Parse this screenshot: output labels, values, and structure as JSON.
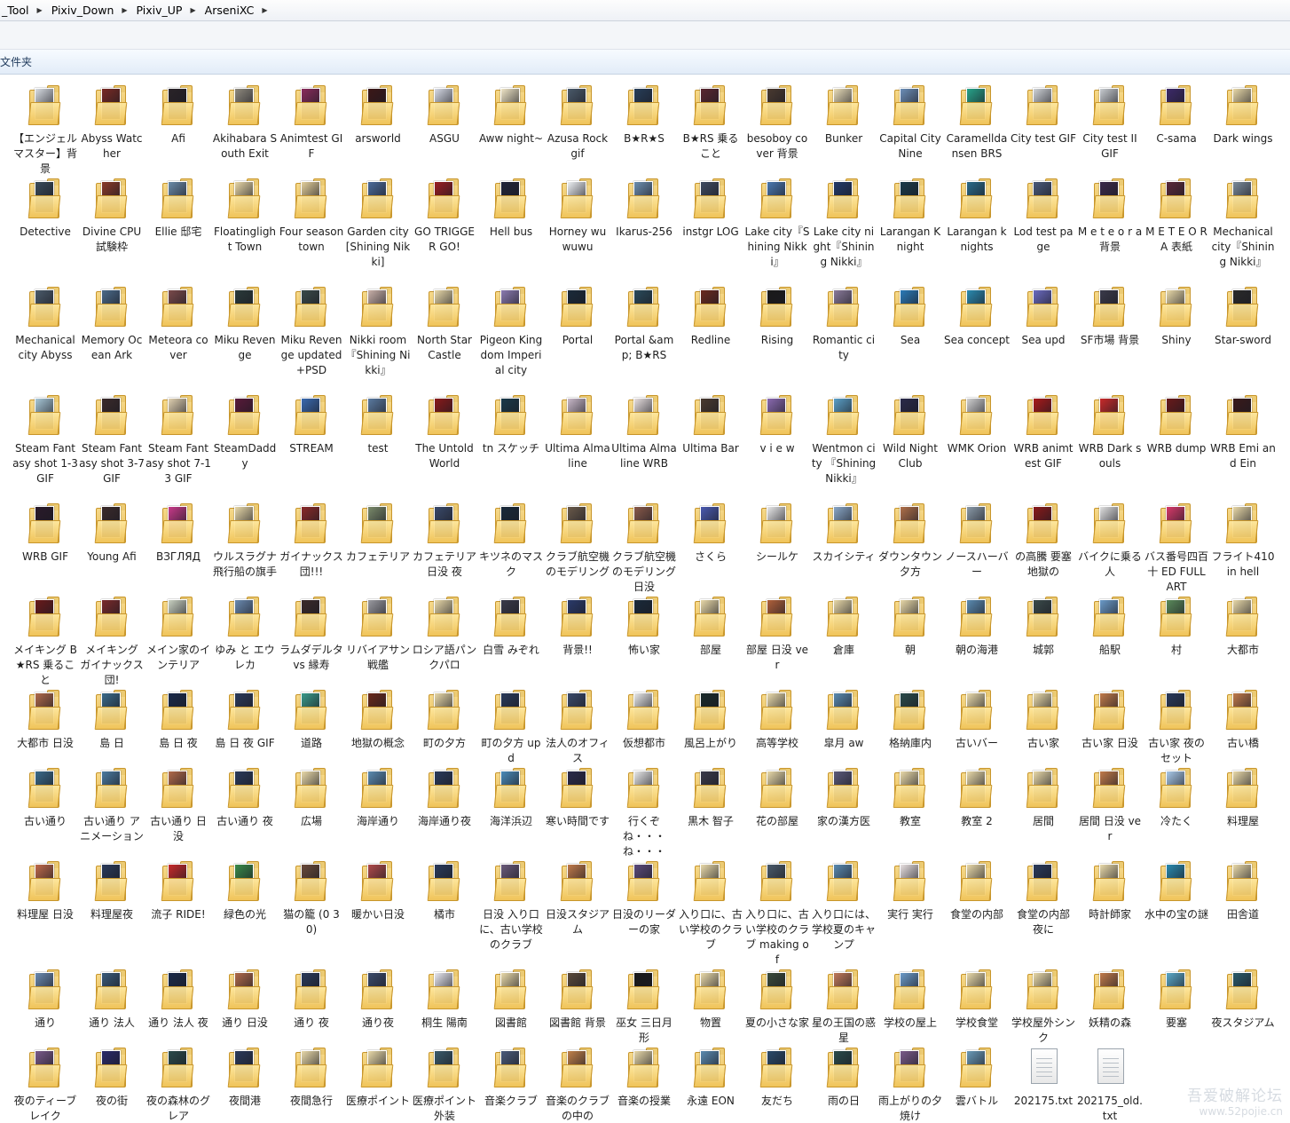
{
  "breadcrumb": [
    "_Tool",
    "Pixiv_Down",
    "Pixiv_UP",
    "ArseniXC"
  ],
  "toolbar": {
    "new_folder_label": "文件夹"
  },
  "watermark": {
    "line1": "吾爱破解论坛",
    "line2": "www.52pojie.cn"
  },
  "items": [
    {
      "label": "【エンジェルマスター】背景",
      "type": "folder",
      "color": "#d8dde3"
    },
    {
      "label": "Abyss Watcher",
      "type": "folder",
      "color": "#7a2a24"
    },
    {
      "label": "Afi",
      "type": "folder",
      "color": "#2a2328"
    },
    {
      "label": "Akihabara South Exit",
      "type": "folder",
      "color": "#8f8a7e"
    },
    {
      "label": "Animtest GIF",
      "type": "folder",
      "color": "#8a2b5c"
    },
    {
      "label": "arsworld",
      "type": "folder",
      "color": "#3c1717"
    },
    {
      "label": "ASGU",
      "type": "folder",
      "color": "#d7dbe6"
    },
    {
      "label": "Aww night~",
      "type": "folder",
      "color": "#efe5c6"
    },
    {
      "label": "Azusa Rock gif",
      "type": "folder",
      "color": "#4a5a6a"
    },
    {
      "label": "B★R★S",
      "type": "folder",
      "color": "#273e59"
    },
    {
      "label": "B★RS 乗ること",
      "type": "folder",
      "color": "#5a2730"
    },
    {
      "label": "besoboy cover 背景",
      "type": "folder",
      "color": "#4a3a30"
    },
    {
      "label": "Bunker",
      "type": "folder",
      "color": "#e8dcb8"
    },
    {
      "label": "Capital City Nine",
      "type": "folder",
      "color": "#6c8fb8"
    },
    {
      "label": "Caramelldansen BRS",
      "type": "folder",
      "color": "#27a38a"
    },
    {
      "label": "City test GIF",
      "type": "folder",
      "color": "#cfd3d7"
    },
    {
      "label": "City test II GIF",
      "type": "folder",
      "color": "#c8ccd0"
    },
    {
      "label": "C-sama",
      "type": "folder",
      "color": "#3d2a6a"
    },
    {
      "label": "Dark wings",
      "type": "folder",
      "color": "#e8d8a8"
    },
    {
      "label": "Detective",
      "type": "folder",
      "color": "#3a4b5a"
    },
    {
      "label": "Divine CPU 試験枠",
      "type": "folder",
      "color": "#8a3a2a"
    },
    {
      "label": "Ellie 邸宅",
      "type": "folder",
      "color": "#6a8aa8"
    },
    {
      "label": "Floatinglight Town",
      "type": "folder",
      "color": "#e7d6a6"
    },
    {
      "label": "Four season town",
      "type": "folder",
      "color": "#e3cf9a"
    },
    {
      "label": "Garden city [Shining Nikki]",
      "type": "folder",
      "color": "#4a6a9a"
    },
    {
      "label": "GO TRIGGER GO!",
      "type": "folder",
      "color": "#9a1e22"
    },
    {
      "label": "Hell bus",
      "type": "folder",
      "color": "#22263a"
    },
    {
      "label": "Horney wuwuwu",
      "type": "folder",
      "color": "#eceff2"
    },
    {
      "label": "Ikarus-256",
      "type": "folder",
      "color": "#6d8fb0"
    },
    {
      "label": "instgr LOG",
      "type": "folder",
      "color": "#3e4a60"
    },
    {
      "label": "Lake city『Shining Nikki』",
      "type": "folder",
      "color": "#4a78b0"
    },
    {
      "label": "Lake city night『Shining Nikki』",
      "type": "folder",
      "color": "#223a6a"
    },
    {
      "label": "Larangan Knight",
      "type": "folder",
      "color": "#1a3a4a"
    },
    {
      "label": "Larangan knights",
      "type": "folder",
      "color": "#2a6a8a"
    },
    {
      "label": "Lod test page",
      "type": "folder",
      "color": "#4a5a7a"
    },
    {
      "label": "M e t e o r a 背景",
      "type": "folder",
      "color": "#3a2a4a"
    },
    {
      "label": "M E T E O R A 表紙",
      "type": "folder",
      "color": "#5a2a3a"
    },
    {
      "label": "Mechanical city『Shining Nikki』",
      "type": "folder",
      "color": "#7a8a9a"
    },
    {
      "label": "Mechanical city Abyss",
      "type": "folder",
      "color": "#4a5a6a"
    },
    {
      "label": "Memory Ocean Ark",
      "type": "folder",
      "color": "#4a6a8a"
    },
    {
      "label": "Meteora cover",
      "type": "folder",
      "color": "#7a4a4a"
    },
    {
      "label": "Miku Revenge",
      "type": "folder",
      "color": "#2a3a3a"
    },
    {
      "label": "Miku Revenge updated +PSD",
      "type": "folder",
      "color": "#3a4a4a"
    },
    {
      "label": "Nikki room『Shining Nikki』",
      "type": "folder",
      "color": "#c8b0a8"
    },
    {
      "label": "North Star Castle",
      "type": "folder",
      "color": "#e8d8a8"
    },
    {
      "label": "Pigeon Kingdom Imperial city",
      "type": "folder",
      "color": "#8a7ab0"
    },
    {
      "label": "Portal",
      "type": "folder",
      "color": "#1a2a3a"
    },
    {
      "label": "Portal &amp; B★RS",
      "type": "folder",
      "color": "#2a4a5a"
    },
    {
      "label": "Redline",
      "type": "folder",
      "color": "#6a2a20"
    },
    {
      "label": "Rising",
      "type": "folder",
      "color": "#1a1a1a"
    },
    {
      "label": "Romantic city",
      "type": "folder",
      "color": "#8a7a9a"
    },
    {
      "label": "Sea",
      "type": "folder",
      "color": "#2a7ab8"
    },
    {
      "label": "Sea concept",
      "type": "folder",
      "color": "#2a8ab0"
    },
    {
      "label": "Sea upd",
      "type": "folder",
      "color": "#6a6ac0"
    },
    {
      "label": "SF市場 背景",
      "type": "folder",
      "color": "#3a3a4a"
    },
    {
      "label": "Shiny",
      "type": "folder",
      "color": "#e8d8a8"
    },
    {
      "label": "Star-sword",
      "type": "folder",
      "color": "#2a2a2a"
    },
    {
      "label": "Steam Fantasy shot 1-3 GIF",
      "type": "folder",
      "color": "#a8c8d8"
    },
    {
      "label": "Steam Fantasy shot 3-7 GIF",
      "type": "folder",
      "color": "#3a2a2a"
    },
    {
      "label": "Steam Fantasy shot 7-13 GIF",
      "type": "folder",
      "color": "#e0d0b0"
    },
    {
      "label": "SteamDaddy",
      "type": "folder",
      "color": "#5a1a3a"
    },
    {
      "label": "STREAM",
      "type": "folder",
      "color": "#3a6ab0"
    },
    {
      "label": "test",
      "type": "folder",
      "color": "#5a7aa0"
    },
    {
      "label": "The Untold World",
      "type": "folder",
      "color": "#8a1a1a"
    },
    {
      "label": "tn スケッチ",
      "type": "folder",
      "color": "#1a3a4a"
    },
    {
      "label": "Ultima Almaline",
      "type": "folder",
      "color": "#c8b8c8"
    },
    {
      "label": "Ultima Almaline WRB",
      "type": "folder",
      "color": "#e8e0e0"
    },
    {
      "label": "Ultima Bar",
      "type": "folder",
      "color": "#4a3a30"
    },
    {
      "label": "v i e w",
      "type": "folder",
      "color": "#8a6ab0"
    },
    {
      "label": "Wentmon city 『Shining Nikki』",
      "type": "folder",
      "color": "#5aa0c8"
    },
    {
      "label": "Wild Night Club",
      "type": "folder",
      "color": "#2a2a4a"
    },
    {
      "label": "WMK Orion",
      "type": "folder",
      "color": "#d0d0d0"
    },
    {
      "label": "WRB animtest GIF",
      "type": "folder",
      "color": "#aa1a1a"
    },
    {
      "label": "WRB Dark souls",
      "type": "folder",
      "color": "#c82a2a"
    },
    {
      "label": "WRB dump",
      "type": "folder",
      "color": "#6a1a1a"
    },
    {
      "label": "WRB Emi and Ein",
      "type": "folder",
      "color": "#3a1a1a"
    },
    {
      "label": "WRB GIF",
      "type": "folder",
      "color": "#2a1a2a"
    },
    {
      "label": "Young Afi",
      "type": "folder",
      "color": "#3a2a2a"
    },
    {
      "label": "ВЗГЛЯД",
      "type": "folder",
      "color": "#c83a8a"
    },
    {
      "label": "ウルスラグナ飛行船の旗手",
      "type": "folder",
      "color": "#e8d8a8"
    },
    {
      "label": "ガイナックス団!!!",
      "type": "folder",
      "color": "#8a2a2a"
    },
    {
      "label": "カフェテリア",
      "type": "folder",
      "color": "#7a8a6a"
    },
    {
      "label": "カフェテリア 日没 夜",
      "type": "folder",
      "color": "#3a4a6a"
    },
    {
      "label": "キツネのマスク",
      "type": "folder",
      "color": "#1a2a3a"
    },
    {
      "label": "クラブ航空機のモデリング",
      "type": "folder",
      "color": "#6a5a4a"
    },
    {
      "label": "クラブ航空機のモデリング 日没",
      "type": "folder",
      "color": "#8a5a4a"
    },
    {
      "label": "さくら",
      "type": "folder",
      "color": "#4a5ab0"
    },
    {
      "label": "シールケ",
      "type": "folder",
      "color": "#e8e8e8"
    },
    {
      "label": "スカイシティ",
      "type": "folder",
      "color": "#8aa8c8"
    },
    {
      "label": "ダウンタウン夕方",
      "type": "folder",
      "color": "#b0704a"
    },
    {
      "label": "ノースハーバー",
      "type": "folder",
      "color": "#8a9aa8"
    },
    {
      "label": "の高騰 要塞 地獄の",
      "type": "folder",
      "color": "#8a1a1a"
    },
    {
      "label": "バイクに乗る人",
      "type": "folder",
      "color": "#e0e0e0"
    },
    {
      "label": "バス番号四百十 ED FULL ART",
      "type": "folder",
      "color": "#d83a6a"
    },
    {
      "label": "フライト410 in hell",
      "type": "folder",
      "color": "#e8d8a8"
    },
    {
      "label": "メイキング B★RS 乗ること",
      "type": "folder",
      "color": "#6a1a1a"
    },
    {
      "label": "メイキング ガイナックス団!",
      "type": "folder",
      "color": "#7a2a2a"
    },
    {
      "label": "メイン家のインテリア",
      "type": "folder",
      "color": "#c8d0c0"
    },
    {
      "label": "ゆみ と エウレカ",
      "type": "folder",
      "color": "#6a8ab0"
    },
    {
      "label": "ラムダデルタ vs 縁寿",
      "type": "folder",
      "color": "#3a2a2a"
    },
    {
      "label": "リバイアサン戦艦",
      "type": "folder",
      "color": "#9a9aa0"
    },
    {
      "label": "ロシア語パンクパロ",
      "type": "folder",
      "color": "#e8d8a8"
    },
    {
      "label": "白雪 みぞれ",
      "type": "folder",
      "color": "#3a3a4a"
    },
    {
      "label": "背景!!",
      "type": "folder",
      "color": "#2a3a6a"
    },
    {
      "label": "怖い家",
      "type": "folder",
      "color": "#1a2a3a"
    },
    {
      "label": "部屋",
      "type": "folder",
      "color": "#e8d8a8"
    },
    {
      "label": "部屋 日没 ver",
      "type": "folder",
      "color": "#b0603a"
    },
    {
      "label": "倉庫",
      "type": "folder",
      "color": "#e8d8a8"
    },
    {
      "label": "朝",
      "type": "folder",
      "color": "#e8d8a8"
    },
    {
      "label": "朝の海港",
      "type": "folder",
      "color": "#5a8ab0"
    },
    {
      "label": "城郭",
      "type": "folder",
      "color": "#3a4a4a"
    },
    {
      "label": "船駅",
      "type": "folder",
      "color": "#6a9ac8"
    },
    {
      "label": "村",
      "type": "folder",
      "color": "#5a8a5a"
    },
    {
      "label": "大都市",
      "type": "folder",
      "color": "#e8d8a8"
    },
    {
      "label": "大都市 日没",
      "type": "folder",
      "color": "#b06a4a"
    },
    {
      "label": "島 日",
      "type": "folder",
      "color": "#3a6a8a"
    },
    {
      "label": "島 日 夜",
      "type": "folder",
      "color": "#1a2a4a"
    },
    {
      "label": "島 日 夜 GIF",
      "type": "folder",
      "color": "#2a3a5a"
    },
    {
      "label": "道路",
      "type": "folder",
      "color": "#3a9a8a"
    },
    {
      "label": "地獄の概念",
      "type": "folder",
      "color": "#6a2a1a"
    },
    {
      "label": "町の夕方",
      "type": "folder",
      "color": "#e8d8a8"
    },
    {
      "label": "町の夕方 upd",
      "type": "folder",
      "color": "#2a3a5a"
    },
    {
      "label": "法人のオフィス",
      "type": "folder",
      "color": "#3a4a6a"
    },
    {
      "label": "仮想都市",
      "type": "folder",
      "color": "#e8e8e8"
    },
    {
      "label": "風呂上がり",
      "type": "folder",
      "color": "#1a2a2a"
    },
    {
      "label": "高等学校",
      "type": "folder",
      "color": "#e8d8a8"
    },
    {
      "label": "皐月 aw",
      "type": "folder",
      "color": "#5a8ab0"
    },
    {
      "label": "格納庫内",
      "type": "folder",
      "color": "#2a4a4a"
    },
    {
      "label": "古いバー",
      "type": "folder",
      "color": "#e8d8a8"
    },
    {
      "label": "古い家",
      "type": "folder",
      "color": "#e8d8a8"
    },
    {
      "label": "古い家 日没",
      "type": "folder",
      "color": "#c07a4a"
    },
    {
      "label": "古い家 夜のセット",
      "type": "folder",
      "color": "#2a3a5a"
    },
    {
      "label": "古い橋",
      "type": "folder",
      "color": "#c07a4a"
    },
    {
      "label": "古い通り",
      "type": "folder",
      "color": "#3a6a8a"
    },
    {
      "label": "古い通り アニメーション",
      "type": "folder",
      "color": "#4a7aa0"
    },
    {
      "label": "古い通り 日没",
      "type": "folder",
      "color": "#b06a4a"
    },
    {
      "label": "古い通り 夜",
      "type": "folder",
      "color": "#2a3a5a"
    },
    {
      "label": "広場",
      "type": "folder",
      "color": "#e8d8a8"
    },
    {
      "label": "海岸通り",
      "type": "folder",
      "color": "#5a8ab0"
    },
    {
      "label": "海岸通り夜",
      "type": "folder",
      "color": "#2a3a5a"
    },
    {
      "label": "海洋浜辺",
      "type": "folder",
      "color": "#4a8ab8"
    },
    {
      "label": "寒い時間です",
      "type": "folder",
      "color": "#2a2a4a"
    },
    {
      "label": "行くぞ ね・・・ね・・・",
      "type": "folder",
      "color": "#e8e8e8"
    },
    {
      "label": "黒木 智子",
      "type": "folder",
      "color": "#3a3a4a"
    },
    {
      "label": "花の部屋",
      "type": "folder",
      "color": "#e8d8a8"
    },
    {
      "label": "家の漢方医",
      "type": "folder",
      "color": "#5a5a7a"
    },
    {
      "label": "教室",
      "type": "folder",
      "color": "#e8d8a8"
    },
    {
      "label": "教室 2",
      "type": "folder",
      "color": "#e8d8a8"
    },
    {
      "label": "居間",
      "type": "folder",
      "color": "#e8d8a8"
    },
    {
      "label": "居間 日没 ver",
      "type": "folder",
      "color": "#c07a4a"
    },
    {
      "label": "冷たく",
      "type": "folder",
      "color": "#a8c8e8"
    },
    {
      "label": "料理屋",
      "type": "folder",
      "color": "#e8d8a8"
    },
    {
      "label": "料理屋 日没",
      "type": "folder",
      "color": "#c06a4a"
    },
    {
      "label": "料理屋夜",
      "type": "folder",
      "color": "#2a3a5a"
    },
    {
      "label": "流子 RIDE!",
      "type": "folder",
      "color": "#c82a2a"
    },
    {
      "label": "緑色の光",
      "type": "folder",
      "color": "#3a8a4a"
    },
    {
      "label": "猫の籠 (0 30)",
      "type": "folder",
      "color": "#6a4a3a"
    },
    {
      "label": "暖かい日没",
      "type": "folder",
      "color": "#b04a4a"
    },
    {
      "label": "橘市",
      "type": "folder",
      "color": "#2a3a5a"
    },
    {
      "label": "日没 入り口に、古い学校のクラブ",
      "type": "folder",
      "color": "#6a5a7a"
    },
    {
      "label": "日没スタジアム",
      "type": "folder",
      "color": "#c07a4a"
    },
    {
      "label": "日没のリーダーの家",
      "type": "folder",
      "color": "#5a4a7a"
    },
    {
      "label": "入り口に、古い学校のクラブ",
      "type": "folder",
      "color": "#e8d8a8"
    },
    {
      "label": "入り口に、古い学校のクラブ making of",
      "type": "folder",
      "color": "#4a5a6a"
    },
    {
      "label": "入り口には、学校夏のキャンプ",
      "type": "folder",
      "color": "#5a8ab0"
    },
    {
      "label": "実行 実行",
      "type": "folder",
      "color": "#e8e0e0"
    },
    {
      "label": "食堂の内部",
      "type": "folder",
      "color": "#e8d8a8"
    },
    {
      "label": "食堂の内部 夜に",
      "type": "folder",
      "color": "#2a3a5a"
    },
    {
      "label": "時計師家",
      "type": "folder",
      "color": "#e8d8a8"
    },
    {
      "label": "水中の宝の謎",
      "type": "folder",
      "color": "#2a8ab0"
    },
    {
      "label": "田舎道",
      "type": "folder",
      "color": "#e8d8a8"
    },
    {
      "label": "通り",
      "type": "folder",
      "color": "#6a8ab0"
    },
    {
      "label": "通り 法人",
      "type": "folder",
      "color": "#3a5a7a"
    },
    {
      "label": "通り 法人 夜",
      "type": "folder",
      "color": "#1a2a4a"
    },
    {
      "label": "通り 日没",
      "type": "folder",
      "color": "#b06a4a"
    },
    {
      "label": "通り 夜",
      "type": "folder",
      "color": "#2a3a5a"
    },
    {
      "label": "通り夜",
      "type": "folder",
      "color": "#3a4a6a"
    },
    {
      "label": "桐生 陽南",
      "type": "folder",
      "color": "#e8e8f0"
    },
    {
      "label": "図書館",
      "type": "folder",
      "color": "#e8d8a8"
    },
    {
      "label": "図書館 背景",
      "type": "folder",
      "color": "#5a4a3a"
    },
    {
      "label": "巫女 三日月形",
      "type": "folder",
      "color": "#1a1a1a"
    },
    {
      "label": "物置",
      "type": "folder",
      "color": "#e8d8a8"
    },
    {
      "label": "夏の小さな家",
      "type": "folder",
      "color": "#3a4a3a"
    },
    {
      "label": "星の王国の惑星",
      "type": "folder",
      "color": "#c07a5a"
    },
    {
      "label": "学校の屋上",
      "type": "folder",
      "color": "#6a9ac8"
    },
    {
      "label": "学校食堂",
      "type": "folder",
      "color": "#e8d8a8"
    },
    {
      "label": "学校屋外シンク",
      "type": "folder",
      "color": "#e8d8a8"
    },
    {
      "label": "妖精の森",
      "type": "folder",
      "color": "#c07a4a"
    },
    {
      "label": "要塞",
      "type": "folder",
      "color": "#5aa8c8"
    },
    {
      "label": "夜スタジアム",
      "type": "folder",
      "color": "#2a5a6a"
    },
    {
      "label": "夜のティーブレイク",
      "type": "folder",
      "color": "#7a5a8a"
    },
    {
      "label": "夜の街",
      "type": "folder",
      "color": "#2a2a6a"
    },
    {
      "label": "夜の森林のグレア",
      "type": "folder",
      "color": "#2a4a4a"
    },
    {
      "label": "夜間港",
      "type": "folder",
      "color": "#2a3a5a"
    },
    {
      "label": "夜間急行",
      "type": "folder",
      "color": "#e8d8a8"
    },
    {
      "label": "医療ポイント",
      "type": "folder",
      "color": "#e8d8a8"
    },
    {
      "label": "医療ポイント 外装",
      "type": "folder",
      "color": "#3a5a6a"
    },
    {
      "label": "音楽クラブ",
      "type": "folder",
      "color": "#4a5a7a"
    },
    {
      "label": "音楽のクラブの中の",
      "type": "folder",
      "color": "#c0804a"
    },
    {
      "label": "音楽の授業",
      "type": "folder",
      "color": "#e8d8a8"
    },
    {
      "label": "永遠 EON",
      "type": "folder",
      "color": "#5a8ab0"
    },
    {
      "label": "友だち",
      "type": "folder",
      "color": "#2a4a6a"
    },
    {
      "label": "雨の日",
      "type": "folder",
      "color": "#2a4a4a"
    },
    {
      "label": "雨上がりの夕焼け",
      "type": "folder",
      "color": "#7a5a8a"
    },
    {
      "label": "雲バトル",
      "type": "folder",
      "color": "#6a9ab8"
    },
    {
      "label": "202175.txt",
      "type": "file",
      "color": "#ffffff"
    },
    {
      "label": "202175_old.txt",
      "type": "file",
      "color": "#ffffff"
    }
  ]
}
